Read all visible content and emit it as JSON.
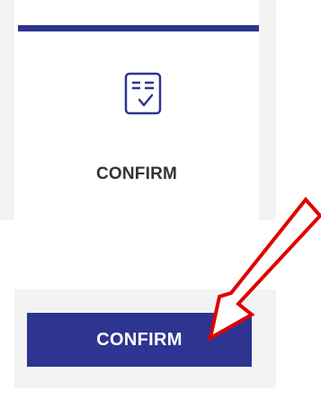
{
  "card": {
    "label": "CONFIRM",
    "icon": "checklist-document-icon",
    "accent_color": "#2e3590",
    "text_color": "#333333"
  },
  "primary_button": {
    "label": "CONFIRM",
    "background_color": "#2e3590",
    "text_color": "#ffffff"
  },
  "annotation": {
    "icon": "red-arrow-icon",
    "color": "#e00000"
  }
}
